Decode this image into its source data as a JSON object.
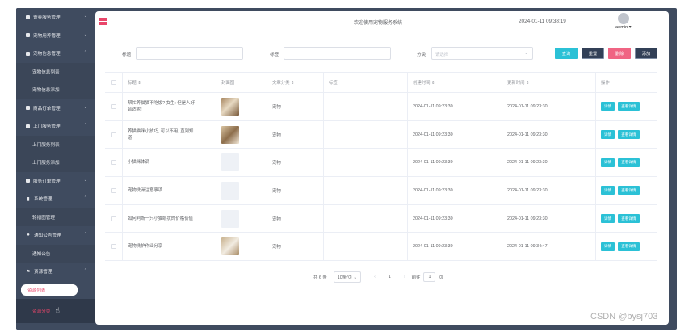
{
  "app": {
    "site_title": "欢迎使用宠物服务系统",
    "datetime": "2024-01-11 09:38:19",
    "user": "admin ▾"
  },
  "sidebar": {
    "items": [
      {
        "label": "寄养服务管理",
        "icon": "square-icon",
        "chevron": "⌄"
      },
      {
        "label": "宠物用养管理",
        "icon": "square-icon",
        "chevron": "⌄"
      },
      {
        "label": "宠物信息管理",
        "icon": "square-icon",
        "chevron": "⌃"
      }
    ],
    "sub_after_3": [
      "宠物信息列表",
      "宠物信息添加"
    ],
    "items2": [
      {
        "label": "商品订单管理",
        "icon": "square-icon",
        "chevron": "⌄"
      },
      {
        "label": "上门服务管理",
        "icon": "square-icon",
        "chevron": "⌃"
      }
    ],
    "sub_after_5": [
      "上门服务列表",
      "上门服务添加"
    ],
    "items3": [
      {
        "label": "服务订单管理",
        "icon": "square-icon",
        "chevron": "⌄"
      },
      {
        "label": "系统管理",
        "icon": "bar-chart-icon",
        "chevron": "⌃"
      }
    ],
    "sub_after_7": [
      "轮播图管理"
    ],
    "items4": [
      {
        "label": "通知公告管理",
        "icon": "info-icon",
        "chevron": "⌃"
      }
    ],
    "sub_after_8": [
      "通知公告"
    ],
    "items5": [
      {
        "label": "资源管理",
        "icon": "flag-icon",
        "chevron": "⌃"
      }
    ],
    "active_sub": "资源列表",
    "hover_sub": "资源分类"
  },
  "filters": {
    "title_label": "标题",
    "tag_label": "标签",
    "category_label": "分类",
    "category_placeholder": "请选择",
    "buttons": {
      "search": "查询",
      "reset": "重置",
      "delete": "删除",
      "add": "添加"
    }
  },
  "colors": {
    "sidebar": "#3f4b5f",
    "accent": "#e9466a",
    "btn_cyan": "#2bc1d6",
    "btn_navy": "#324057",
    "btn_pink": "#f06483"
  },
  "table": {
    "headers": [
      "",
      "标题 ⇕",
      "封面图",
      "文章分类 ⇕",
      "标签",
      "创建时间 ⇕",
      "更新时间 ⇕",
      "操作"
    ],
    "rows": [
      {
        "title": "帮忙养猫猫不吃饭? 女生: 但是人好\n合适呢!",
        "thumb": "a",
        "category": "宠物",
        "tag": "",
        "created": "2024-01-11 09:23:30",
        "updated": "2024-01-11 09:23:30"
      },
      {
        "title": "养猫猫咪小技巧, 可以不用, 直到知\n道",
        "thumb": "b",
        "category": "宠物",
        "tag": "",
        "created": "2024-01-11 09:23:30",
        "updated": "2024-01-11 09:23:30"
      },
      {
        "title": "小猫咪体调",
        "thumb": "c",
        "category": "宠物",
        "tag": "",
        "created": "2024-01-11 09:23:30",
        "updated": "2024-01-11 09:23:30"
      },
      {
        "title": "宠物洗澡注意事项",
        "thumb": "c",
        "category": "宠物",
        "tag": "",
        "created": "2024-01-11 09:23:30",
        "updated": "2024-01-11 09:23:30"
      },
      {
        "title": "如何判断一只小猫眼状的价格价值",
        "thumb": "c",
        "category": "宠物",
        "tag": "",
        "created": "2024-01-11 09:23:30",
        "updated": "2024-01-11 09:23:30"
      },
      {
        "title": "宠物洗护作业分享",
        "thumb": "d",
        "category": "宠物",
        "tag": "",
        "created": "2024-01-11 09:23:30",
        "updated": "2024-01-11 09:34:47"
      }
    ],
    "op_labels": {
      "edit": "详情",
      "view": "查看详情"
    }
  },
  "pager": {
    "total": "共 6 条",
    "sizes": "10条/页 ⌄",
    "prev": "‹",
    "page": "1",
    "next": "›",
    "jump_label": "前往",
    "jump_value": "1",
    "jump_suffix": "页"
  },
  "watermark": "CSDN @bysj703"
}
